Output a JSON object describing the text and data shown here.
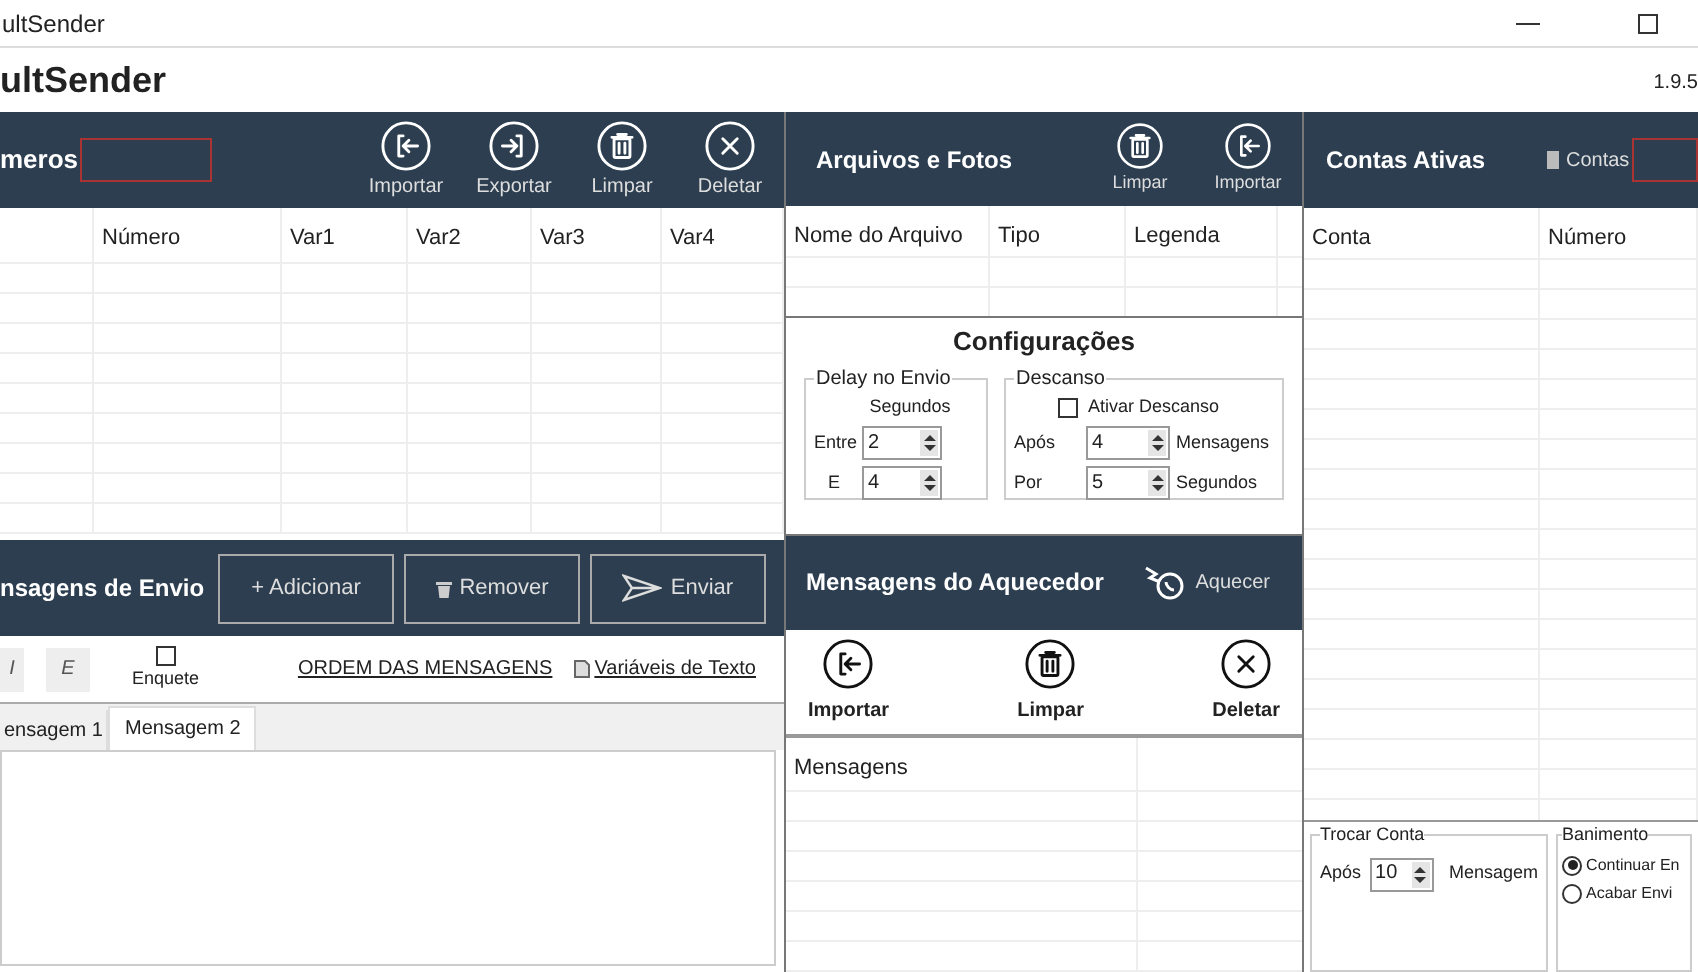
{
  "window": {
    "title": "ultSender"
  },
  "app_header": {
    "title": "ultSender",
    "version": "1.9.5"
  },
  "numbers_panel": {
    "title": "meros",
    "actions": [
      {
        "label": "Importar",
        "kind": "import"
      },
      {
        "label": "Exportar",
        "kind": "export"
      },
      {
        "label": "Limpar",
        "kind": "clear"
      },
      {
        "label": "Deletar",
        "kind": "delete"
      }
    ],
    "table": {
      "columns": [
        "Número",
        "Var1",
        "Var2",
        "Var3",
        "Var4"
      ]
    }
  },
  "files_panel": {
    "title": "Arquivos e Fotos",
    "actions": [
      {
        "label": "Limpar",
        "kind": "clear"
      },
      {
        "label": "Importar",
        "kind": "import"
      }
    ],
    "table": {
      "columns": [
        "Nome do Arquivo",
        "Tipo",
        "Legenda"
      ]
    }
  },
  "accounts_panel": {
    "title": "Contas Ativas",
    "filter_label": "Contas",
    "table": {
      "columns": [
        "Conta",
        "Número"
      ]
    }
  },
  "settings": {
    "title": "Configurações",
    "delay": {
      "title": "Delay no Envio",
      "unit": "Segundos",
      "fields": [
        {
          "label": "Entre",
          "value": "2"
        },
        {
          "label": "E",
          "value": "4"
        }
      ]
    },
    "rest": {
      "title": "Descanso",
      "toggle": {
        "label": "Ativar Descanso",
        "checked": false
      },
      "fields": [
        {
          "label": "Após",
          "value": "4",
          "unit": "Mensagens"
        },
        {
          "label": "Por",
          "value": "5",
          "unit": "Segundos"
        }
      ]
    }
  },
  "send_panel": {
    "title": "nsagens de Envio",
    "actions": [
      {
        "label": "+ Adicionar",
        "kind": "add"
      },
      {
        "label": "Remover",
        "kind": "remove"
      },
      {
        "label": "Enviar",
        "kind": "send"
      }
    ],
    "format_buttons": [
      "I",
      "E"
    ],
    "poll": {
      "label": "Enquete",
      "checked": false
    },
    "links": [
      {
        "label": "ORDEM DAS MENSAGENS",
        "kind": "plain"
      },
      {
        "label": "Variáveis de Texto",
        "kind": "doc"
      }
    ],
    "tabs": [
      {
        "label": "ensagem 1",
        "selected": false
      },
      {
        "label": "Mensagem 2",
        "selected": true
      }
    ]
  },
  "warmup_panel": {
    "title": "Mensagens do Aquecedor",
    "action": "Aquecer",
    "tools": [
      {
        "label": "Importar",
        "kind": "import"
      },
      {
        "label": "Limpar",
        "kind": "clear"
      },
      {
        "label": "Deletar",
        "kind": "delete"
      }
    ],
    "table": {
      "columns": [
        "Mensagens"
      ]
    }
  },
  "switch_account": {
    "title": "Trocar Conta",
    "label": "Após",
    "value": "10",
    "unit": "Mensagem"
  },
  "ban": {
    "title": "Banimento",
    "options": [
      {
        "label": "Continuar En",
        "selected": true
      },
      {
        "label": "Acabar Envi",
        "selected": false
      }
    ]
  }
}
